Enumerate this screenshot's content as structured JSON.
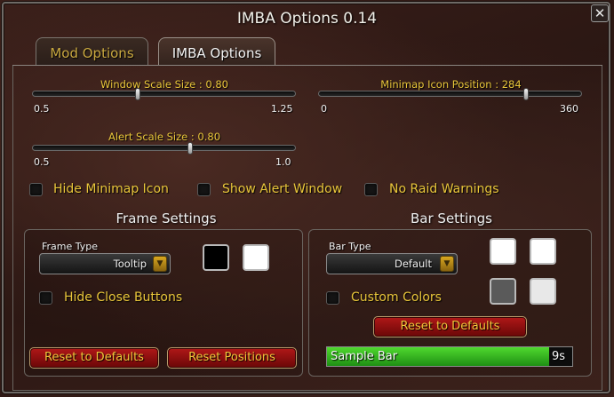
{
  "window": {
    "title": "IMBA Options 0.14",
    "close_glyph": "✕"
  },
  "tabs": [
    {
      "label": "Mod Options",
      "active": false
    },
    {
      "label": "IMBA Options",
      "active": true
    }
  ],
  "sliders": {
    "window_scale": {
      "label": "Window Scale Size : 0.80",
      "min": "0.5",
      "max": "1.25",
      "value": 0.8
    },
    "minimap_icon": {
      "label": "Minimap Icon Position : 284",
      "min": "0",
      "max": "360",
      "value": 284
    },
    "alert_scale": {
      "label": "Alert Scale Size : 0.80",
      "min": "0.5",
      "max": "1.0",
      "value": 0.8
    }
  },
  "checkboxes": {
    "hide_minimap_icon": {
      "label": "Hide Minimap Icon",
      "checked": false
    },
    "show_alert_window": {
      "label": "Show Alert Window",
      "checked": false
    },
    "no_raid_warnings": {
      "label": "No Raid Warnings",
      "checked": false
    }
  },
  "frame_settings": {
    "title": "Frame Settings",
    "frame_type_label": "Frame Type",
    "frame_type_value": "Tooltip",
    "swatches": [
      "#000000",
      "#ffffff"
    ],
    "hide_close_buttons": {
      "label": "Hide Close Buttons",
      "checked": false
    },
    "reset_defaults_label": "Reset to Defaults",
    "reset_positions_label": "Reset Positions"
  },
  "bar_settings": {
    "title": "Bar Settings",
    "bar_type_label": "Bar Type",
    "bar_type_value": "Default",
    "swatches": [
      "#ffffff",
      "#ffffff",
      "#5a5a5a",
      "#e8e8e8"
    ],
    "custom_colors": {
      "label": "Custom Colors",
      "checked": false
    },
    "reset_defaults_label": "Reset to Defaults",
    "sample_bar": {
      "label": "Sample Bar",
      "time": "9s",
      "fill": 0.905,
      "color": "#3fbf22"
    }
  },
  "colors": {
    "label_gold": "#e8c53a",
    "button_red": "#9a1010"
  }
}
